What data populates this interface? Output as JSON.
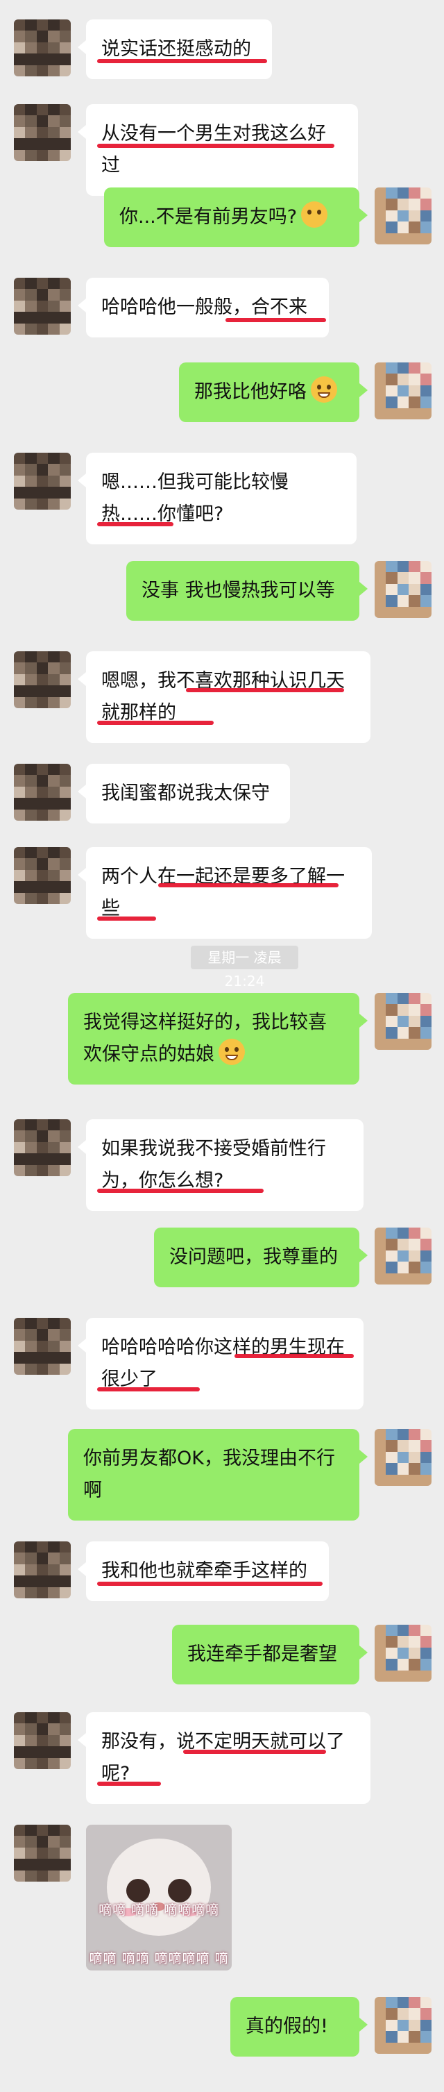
{
  "chat": {
    "messages": [
      {
        "side": "in",
        "text": "说实话还挺感动的"
      },
      {
        "side": "in",
        "text": "从没有一个男生对我这么好过"
      },
      {
        "side": "out",
        "text": "你...不是有前男友吗?",
        "emoji": "flushed-face"
      },
      {
        "side": "in",
        "text": "哈哈哈他一般般，合不来"
      },
      {
        "side": "out",
        "text": "那我比他好咯",
        "emoji": "grinning-face"
      },
      {
        "side": "in",
        "text": "嗯……但我可能比较慢热……你懂吧?"
      },
      {
        "side": "out",
        "text": "没事 我也慢热我可以等"
      },
      {
        "side": "in",
        "text": "嗯嗯，我不喜欢那种认识几天就那样的"
      },
      {
        "side": "in",
        "text": "我闺蜜都说我太保守"
      },
      {
        "side": "in",
        "text": "两个人在一起还是要多了解一些"
      },
      {
        "side": "out",
        "text": "我觉得这样挺好的，我比较喜欢保守点的姑娘",
        "emoji": "grinning-face"
      },
      {
        "side": "in",
        "text": "如果我说我不接受婚前性行为，你怎么想?"
      },
      {
        "side": "out",
        "text": "没问题吧，我尊重的"
      },
      {
        "side": "in",
        "text": "哈哈哈哈哈你这样的男生现在很少了"
      },
      {
        "side": "out",
        "text": "你前男友都OK，我没理由不行啊"
      },
      {
        "side": "in",
        "text": "我和他也就牵牵手这样的"
      },
      {
        "side": "out",
        "text": "我连牵手都是奢望"
      },
      {
        "side": "in",
        "text": "那没有，说不定明天就可以了呢?"
      },
      {
        "side": "out",
        "text": "真的假的!"
      }
    ],
    "timestamp": "星期一 凌晨21:24",
    "sticker": {
      "caption_top": "嘀嘀 嘀嘀 嘀嘀嘀嘀",
      "caption_bottom": "嘀嘀 嘀嘀 嘀嘀嘀嘀 嘀"
    }
  },
  "colors": {
    "background": "#ededed",
    "incoming_bubble": "#ffffff",
    "outgoing_bubble": "#95ec69",
    "highlight": "#e5102a"
  }
}
